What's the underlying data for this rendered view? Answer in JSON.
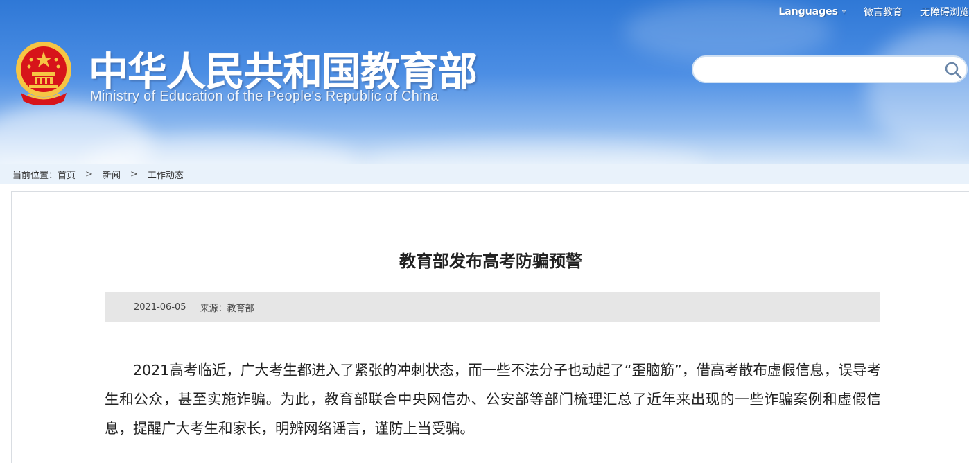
{
  "header": {
    "title": "中华人民共和国教育部",
    "subtitle": "Ministry of Education of the People's Republic of China",
    "top_links": {
      "languages": "Languages",
      "weibo": "微言教育",
      "accessibility": "无障碍浏览"
    },
    "search": {
      "placeholder": "",
      "icon": "search-icon"
    },
    "colors": {
      "sky_top": "#2f78d6",
      "sky_bottom": "#d8e8f9",
      "emblem_red": "#d7141a",
      "emblem_gold": "#f6c544"
    }
  },
  "breadcrumb": {
    "prefix": "当前位置：",
    "items": [
      "首页",
      "新闻",
      "工作动态"
    ],
    "separator": ">"
  },
  "article": {
    "title": "教育部发布高考防骗预警",
    "date": "2021-06-05",
    "source_label": "来源：",
    "source": "教育部",
    "body": "2021高考临近，广大考生都进入了紧张的冲刺状态，而一些不法分子也动起了“歪脑筋”，借高考散布虚假信息，误导考生和公众，甚至实施诈骗。为此，教育部联合中央网信办、公安部等部门梳理汇总了近年来出现的一些诈骗案例和虚假信息，提醒广大考生和家长，明辨网络谣言，谨防上当受骗。"
  }
}
